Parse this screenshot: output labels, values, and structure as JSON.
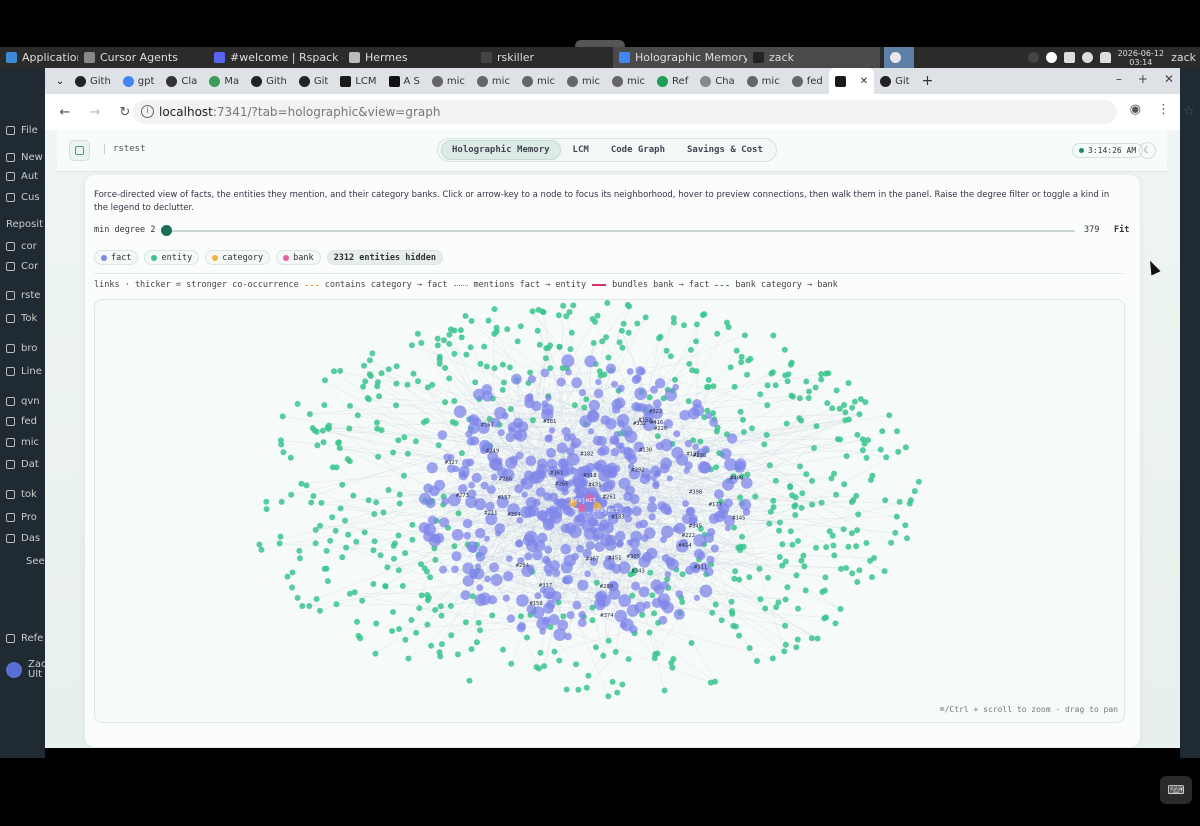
{
  "taskbar": {
    "items": [
      {
        "label": "Applications",
        "color": "#3d8bd8"
      },
      {
        "label": "Cursor Agents",
        "color": "#888888"
      },
      {
        "label": "#welcome | Rspack - ...",
        "color": "#5865f2"
      },
      {
        "label": "Hermes",
        "color": "#bbbbbb"
      },
      {
        "label": "rskiller",
        "color": "#444444"
      },
      {
        "label": "Holographic Memory ...",
        "color": "#4285f4"
      },
      {
        "label": "zack",
        "color": "#222222"
      }
    ],
    "clock_date": "2026-06-12",
    "clock_time": "03:14",
    "user": "zack"
  },
  "sidebar": {
    "items": [
      "File",
      "New",
      "Aut",
      "Cus",
      "Reposit",
      "cor",
      "Cor",
      "rste",
      "Tok",
      "bro",
      "Line",
      "qvn",
      "fed",
      "mic",
      "Dat",
      "tok",
      "Pro",
      "Das",
      "See",
      "Refe",
      "Zac",
      "Ult"
    ]
  },
  "browser": {
    "tabs": [
      "Gith",
      "gpt",
      "Cla",
      "Ma",
      "Gith",
      "Git",
      "LCM",
      "A S",
      "mic",
      "mic",
      "mic",
      "mic",
      "mic",
      "Ref",
      "Cha",
      "mic",
      "fed",
      "",
      "Git"
    ],
    "url_host": "localhost",
    "url_path": ":7341/?tab=holographic&view=graph"
  },
  "app": {
    "project": "rstest",
    "tabs": [
      "Holographic Memory",
      "LCM",
      "Code Graph",
      "Savings & Cost"
    ],
    "active_tab": "Holographic Memory",
    "time": "3:14:26 AM",
    "theme_icon": "moon-icon"
  },
  "graph_panel": {
    "description": "Force-directed view of facts, the entities they mention, and their category banks. Click or arrow-key to a node to focus its neighborhood, hover to preview connections, then walk them in the panel. Raise the degree filter or toggle a kind in the legend to declutter.",
    "min_degree_label": "min degree",
    "min_degree": "2",
    "max_degree": "379",
    "fit_label": "Fit",
    "legend": [
      {
        "label": "fact",
        "color": "#7f86ea"
      },
      {
        "label": "entity",
        "color": "#39c48d"
      },
      {
        "label": "category",
        "color": "#f2b33a"
      },
      {
        "label": "bank",
        "color": "#e35fa0"
      }
    ],
    "hidden_label": "2312 entities hidden",
    "links_intro": "links · thicker = stronger co-occurrence",
    "link_types": [
      {
        "label": "contains category → fact",
        "color": "#e8a13a",
        "style": "dashed"
      },
      {
        "label": "mentions fact → entity",
        "color": "#8a8fa0",
        "style": "dotted"
      },
      {
        "label": "bundles bank → fact",
        "color": "#d6336c",
        "style": "solid"
      },
      {
        "label": "bank category → bank",
        "color": "#6b7280",
        "style": "dashdot"
      }
    ],
    "hint": "⌘/Ctrl + scroll to zoom · drag to pan",
    "node_labels": [
      "#249",
      "#286",
      "#195",
      "#157",
      "#298",
      "#266",
      "#345",
      "#332",
      "#374",
      "#182",
      "#318",
      "#261",
      "#289",
      "#337",
      "#284",
      "#167",
      "#416",
      "#467",
      "#327",
      "#158",
      "#343",
      "#311",
      "#408",
      "#451",
      "#211",
      "#183",
      "#222",
      "#431",
      "#130",
      "#226",
      "#273",
      "#152",
      "#177",
      "#305",
      "#361",
      "#292",
      "#414",
      "#354",
      "#322",
      "#381",
      "#145",
      "#398"
    ],
    "hub_labels": [
      "project",
      "project"
    ]
  }
}
